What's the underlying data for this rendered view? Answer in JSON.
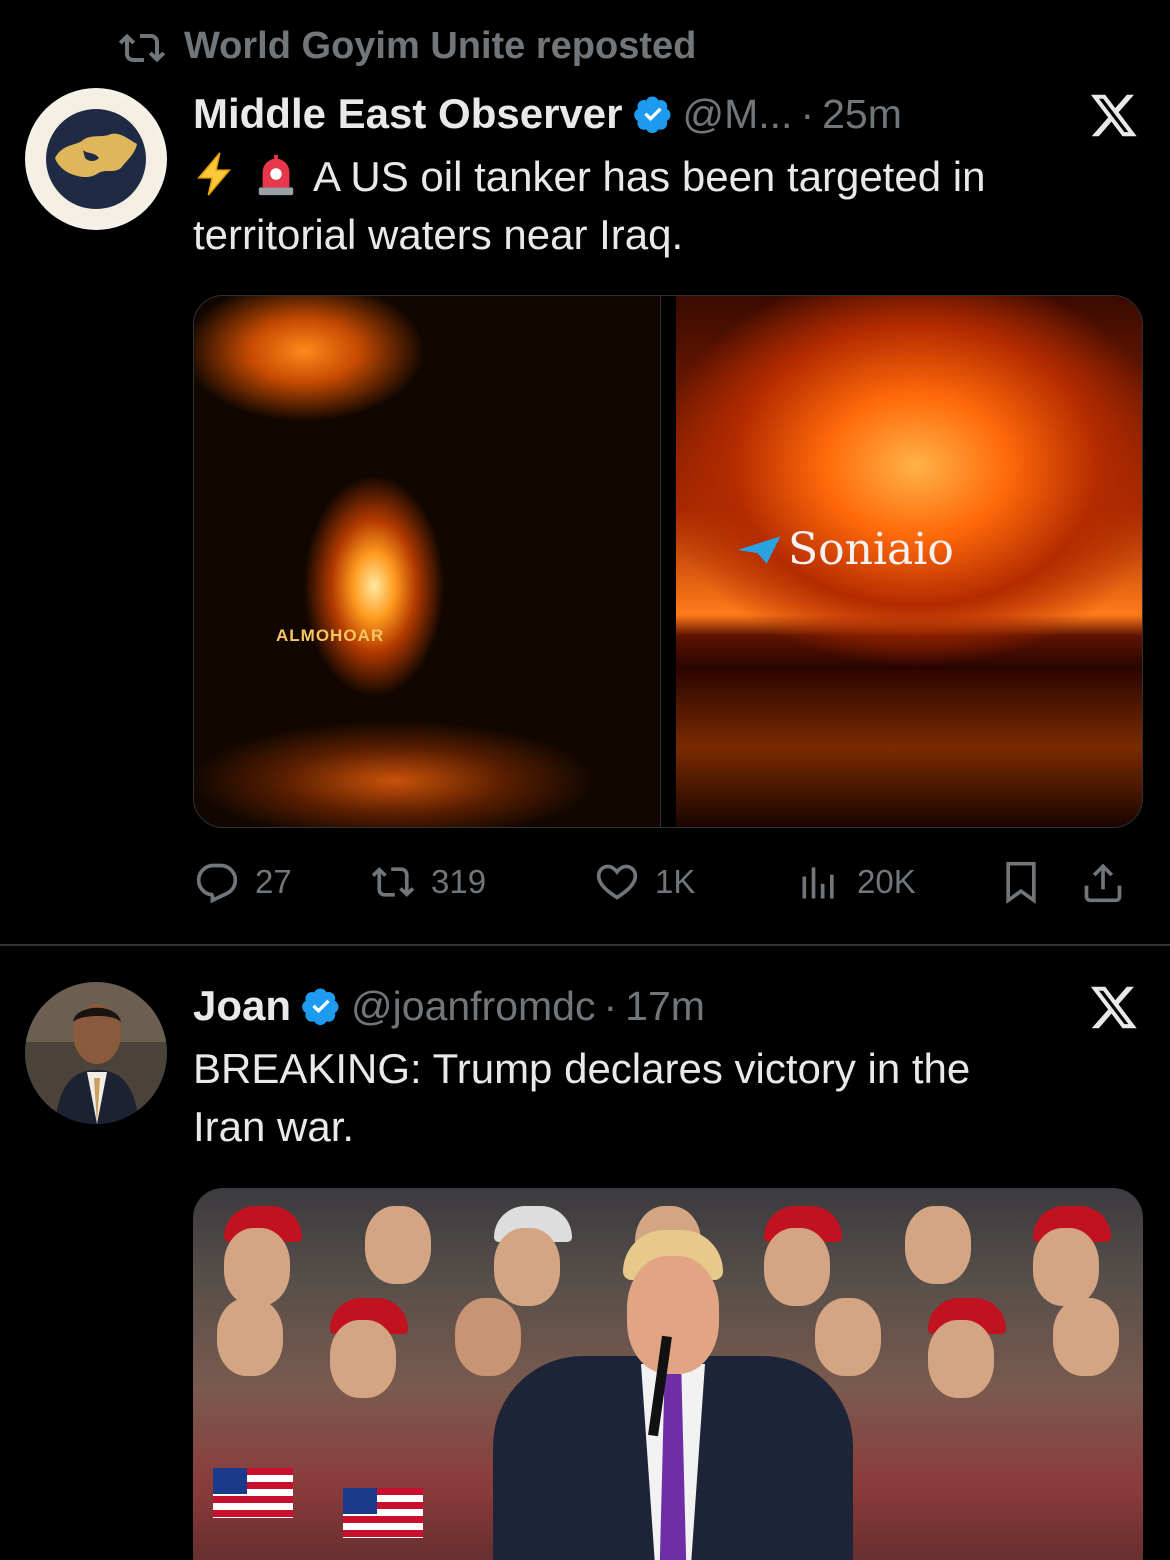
{
  "repost": {
    "text": "World Goyim Unite reposted"
  },
  "tweets": [
    {
      "name": "Middle East Observer",
      "handle": "@M...",
      "separator": "·",
      "time": "25m",
      "verified": true,
      "text_line1": "A US oil tanker has been targeted in",
      "text_line2": "territorial waters near Iraq.",
      "media_watermarks": [
        "ALMOHOAR",
        "Soniaio"
      ],
      "stats": {
        "replies": "27",
        "reposts": "319",
        "likes": "1K",
        "views": "20K"
      }
    },
    {
      "name": "Joan",
      "handle": "@joanfromdc",
      "separator": "·",
      "time": "17m",
      "verified": true,
      "text_line1": "BREAKING: Trump declares victory in the",
      "text_line2": "Iran war."
    }
  ],
  "icons": {
    "repost": "repost-icon",
    "verified": "verified-badge-icon",
    "x_logo": "x-logo-icon",
    "reply": "reply-icon",
    "like": "heart-icon",
    "views": "views-icon",
    "bookmark": "bookmark-icon",
    "share": "share-icon",
    "lightning": "lightning-icon",
    "siren": "siren-icon"
  },
  "colors": {
    "background": "#000000",
    "text": "#e7e9ea",
    "muted": "#71767b",
    "verified": "#1d9bf0",
    "divider": "#2f3336"
  }
}
